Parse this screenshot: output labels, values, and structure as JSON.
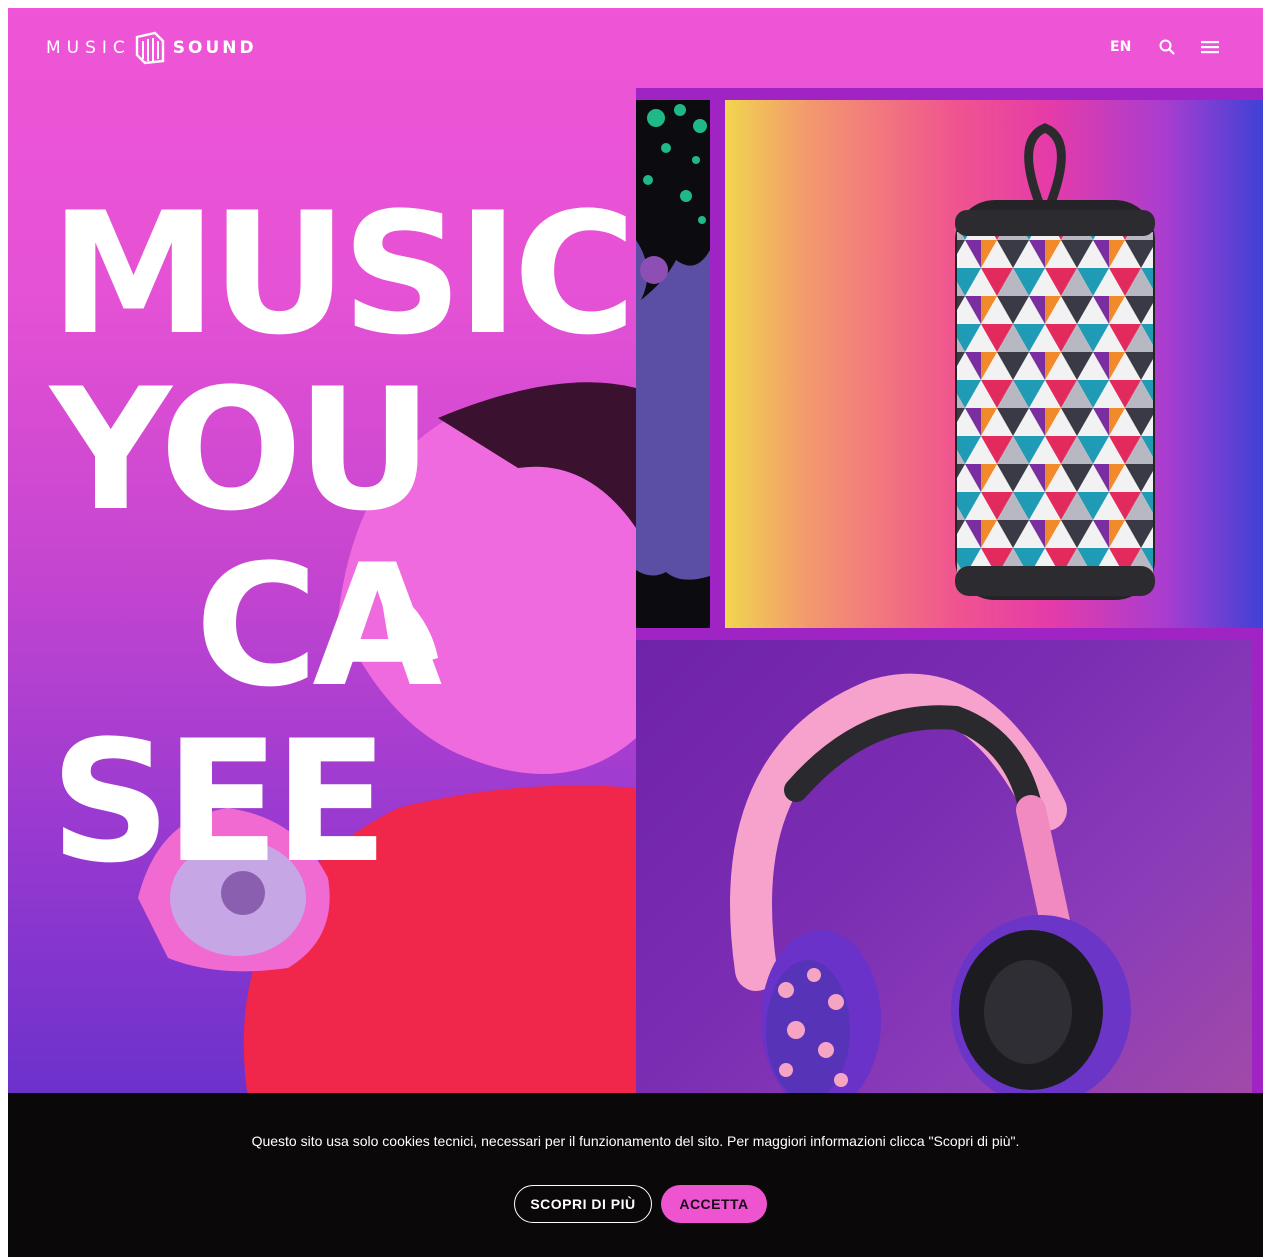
{
  "header": {
    "logo_left": "MUSIC",
    "logo_right": "SOUND",
    "lang": "EN",
    "search_icon": "search-icon",
    "menu_icon": "hamburger-menu-icon"
  },
  "hero": {
    "title_lines": [
      "MUSIC",
      "YOU",
      "CA",
      "SEE"
    ]
  },
  "products": {
    "speaker_image": "patterned-bluetooth-speaker",
    "headphones_image": "leopard-print-headphones"
  },
  "cookie_banner": {
    "text": "Questo sito usa solo cookies tecnici, necessari per il funzionamento del sito. Per maggiori informazioni clicca \"Scopri di più\".",
    "more_label": "SCOPRI DI PIÙ",
    "accept_label": "ACCETTA"
  },
  "colors": {
    "brand_pink": "#ee54cf",
    "panel_purple": "#a024c4",
    "banner_bg": "#0a0808"
  }
}
